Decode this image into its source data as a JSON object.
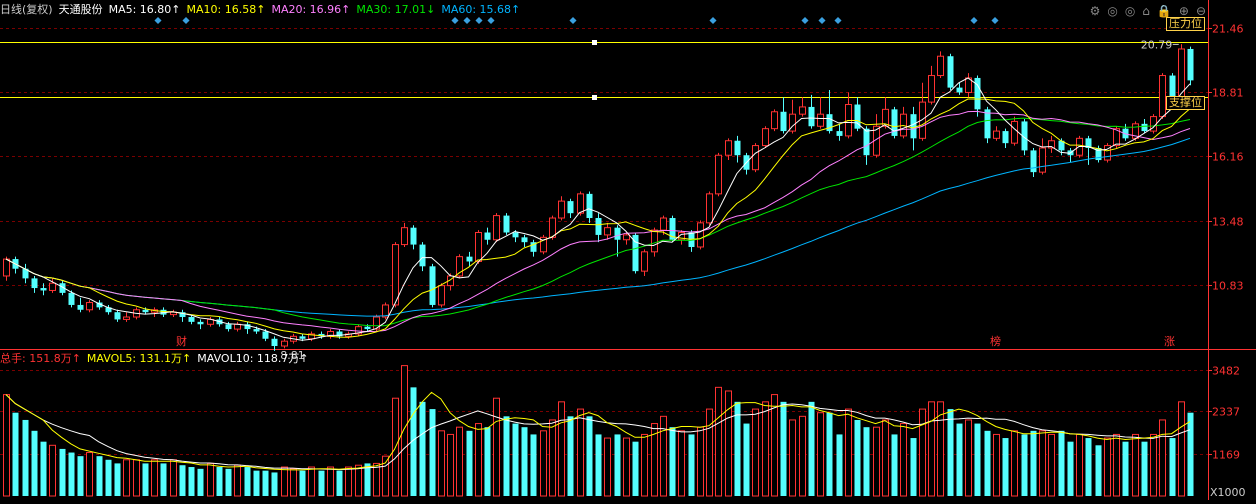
{
  "kline_header": {
    "period": "日线(复权)",
    "stock": "天通股份",
    "ma5": "MA5: 16.80↑",
    "ma10": "MA10: 16.58↑",
    "ma20": "MA20: 16.96↑",
    "ma30": "MA30: 17.01↓",
    "ma60": "MA60: 15.68↑"
  },
  "volume_header": {
    "total": "总手: 151.8万↑",
    "mavol5": "MAVOL5: 131.1万↑",
    "mavol10": "MAVOL10: 118.7万↑"
  },
  "toolbar_icons": [
    "settings-icon",
    "view-icon",
    "view2-icon",
    "home-icon",
    "lock-icon",
    "zoom-in-icon",
    "zoom-out-icon"
  ],
  "toolbar_glyphs": [
    "⚙",
    "◎",
    "◎",
    "⌂",
    "🔒",
    "⊕",
    "⊖"
  ],
  "levels": {
    "resistance": {
      "label": "压力位",
      "value": 20.9
    },
    "support": {
      "label": "支撑位",
      "value": 18.6
    }
  },
  "annotations": {
    "high": "20.79",
    "low": "8.81",
    "markers": [
      "财",
      "榜",
      "涨"
    ]
  },
  "colors": {
    "up": "#ff3232",
    "down": "#54ffff",
    "ma5": "#ffffff",
    "ma10": "#ffff00",
    "ma20": "#ff80ff",
    "ma30": "#00e600",
    "ma60": "#00b4ff",
    "grid": "#7a0000",
    "axis": "#ff3232",
    "level_line": "#ffff00"
  },
  "chart_data": [
    {
      "type": "candlestick",
      "yticks": [
        "10.83",
        "13.48",
        "16.16",
        "18.81",
        "21.46"
      ],
      "ylim": [
        8.3,
        21.8
      ],
      "grid": true,
      "candles": [
        [
          11.2,
          11.9,
          11.0,
          12.0
        ],
        [
          11.9,
          11.5,
          11.3,
          12.0
        ],
        [
          11.5,
          11.1,
          10.9,
          11.7
        ],
        [
          11.1,
          10.7,
          10.5,
          11.2
        ],
        [
          10.7,
          10.6,
          10.4,
          10.9
        ],
        [
          10.6,
          10.9,
          10.5,
          11.1
        ],
        [
          10.9,
          10.5,
          10.4,
          11.0
        ],
        [
          10.5,
          10.0,
          9.9,
          10.6
        ],
        [
          10.0,
          9.8,
          9.7,
          10.3
        ],
        [
          9.8,
          10.1,
          9.7,
          10.2
        ],
        [
          10.1,
          9.9,
          9.8,
          10.2
        ],
        [
          9.9,
          9.7,
          9.6,
          10.0
        ],
        [
          9.7,
          9.4,
          9.3,
          9.8
        ],
        [
          9.4,
          9.5,
          9.3,
          9.7
        ],
        [
          9.5,
          9.8,
          9.4,
          9.9
        ],
        [
          9.8,
          9.7,
          9.6,
          9.9
        ],
        [
          9.7,
          9.8,
          9.5,
          9.9
        ],
        [
          9.8,
          9.6,
          9.5,
          9.9
        ],
        [
          9.6,
          9.7,
          9.5,
          9.8
        ],
        [
          9.7,
          9.5,
          9.3,
          9.8
        ],
        [
          9.5,
          9.3,
          9.2,
          9.6
        ],
        [
          9.3,
          9.2,
          9.0,
          9.4
        ],
        [
          9.2,
          9.4,
          9.1,
          9.5
        ],
        [
          9.4,
          9.2,
          9.1,
          9.5
        ],
        [
          9.2,
          9.0,
          8.9,
          9.3
        ],
        [
          9.0,
          9.2,
          8.9,
          9.3
        ],
        [
          9.2,
          9.0,
          8.8,
          9.3
        ],
        [
          9.0,
          8.9,
          8.8,
          9.1
        ],
        [
          8.9,
          8.6,
          8.5,
          9.0
        ],
        [
          8.6,
          8.3,
          8.1,
          8.7
        ],
        [
          8.3,
          8.5,
          8.2,
          8.6
        ],
        [
          8.5,
          8.7,
          8.4,
          8.8
        ],
        [
          8.7,
          8.6,
          8.5,
          8.8
        ],
        [
          8.6,
          8.8,
          8.5,
          8.9
        ],
        [
          8.8,
          8.7,
          8.6,
          8.9
        ],
        [
          8.7,
          8.9,
          8.6,
          9.0
        ],
        [
          8.9,
          8.7,
          8.6,
          9.0
        ],
        [
          8.7,
          8.8,
          8.6,
          8.9
        ],
        [
          8.8,
          9.1,
          8.7,
          9.2
        ],
        [
          9.1,
          9.0,
          8.9,
          9.2
        ],
        [
          9.0,
          9.5,
          8.9,
          9.6
        ],
        [
          9.5,
          10.0,
          9.4,
          10.1
        ],
        [
          10.0,
          12.5,
          9.9,
          12.6
        ],
        [
          12.5,
          13.2,
          12.4,
          13.4
        ],
        [
          13.2,
          12.5,
          12.3,
          13.3
        ],
        [
          12.5,
          11.6,
          11.4,
          12.6
        ],
        [
          11.6,
          10.0,
          9.9,
          11.7
        ],
        [
          10.0,
          10.8,
          9.9,
          10.9
        ],
        [
          10.8,
          11.2,
          10.6,
          11.3
        ],
        [
          11.2,
          12.0,
          11.1,
          12.1
        ],
        [
          12.0,
          11.8,
          11.6,
          12.2
        ],
        [
          11.8,
          13.0,
          11.7,
          13.1
        ],
        [
          13.0,
          12.7,
          12.5,
          13.2
        ],
        [
          12.7,
          13.7,
          12.6,
          13.8
        ],
        [
          13.7,
          13.0,
          12.9,
          13.8
        ],
        [
          13.0,
          12.8,
          12.6,
          13.1
        ],
        [
          12.8,
          12.6,
          12.4,
          12.9
        ],
        [
          12.6,
          12.2,
          12.0,
          12.7
        ],
        [
          12.2,
          12.8,
          12.1,
          12.9
        ],
        [
          12.8,
          13.6,
          12.7,
          13.7
        ],
        [
          13.6,
          14.3,
          13.5,
          14.5
        ],
        [
          14.3,
          13.8,
          13.6,
          14.4
        ],
        [
          13.8,
          14.6,
          13.7,
          14.7
        ],
        [
          14.6,
          13.6,
          13.4,
          14.7
        ],
        [
          13.6,
          12.9,
          12.6,
          13.8
        ],
        [
          12.9,
          13.2,
          12.7,
          13.4
        ],
        [
          13.2,
          12.7,
          12.0,
          13.3
        ],
        [
          12.7,
          12.9,
          12.5,
          13.0
        ],
        [
          12.9,
          11.4,
          11.3,
          13.0
        ],
        [
          11.4,
          12.2,
          11.2,
          12.3
        ],
        [
          12.2,
          13.1,
          12.0,
          13.2
        ],
        [
          13.1,
          13.6,
          12.9,
          13.7
        ],
        [
          13.6,
          12.7,
          12.6,
          13.7
        ],
        [
          12.7,
          13.0,
          12.5,
          13.1
        ],
        [
          13.0,
          12.4,
          12.2,
          13.1
        ],
        [
          12.4,
          13.4,
          12.3,
          13.5
        ],
        [
          13.4,
          14.6,
          13.3,
          14.7
        ],
        [
          14.6,
          16.2,
          14.5,
          16.3
        ],
        [
          16.2,
          16.8,
          16.0,
          16.9
        ],
        [
          16.8,
          16.2,
          15.9,
          17.0
        ],
        [
          16.2,
          15.6,
          15.4,
          16.3
        ],
        [
          15.6,
          16.6,
          15.5,
          16.7
        ],
        [
          16.6,
          17.3,
          16.5,
          17.4
        ],
        [
          17.3,
          18.0,
          17.2,
          18.1
        ],
        [
          18.0,
          17.2,
          17.1,
          18.6
        ],
        [
          17.2,
          17.9,
          17.1,
          18.5
        ],
        [
          17.9,
          18.2,
          17.8,
          18.6
        ],
        [
          18.2,
          17.4,
          17.3,
          18.7
        ],
        [
          17.4,
          17.9,
          17.3,
          18.6
        ],
        [
          17.9,
          17.2,
          17.1,
          18.9
        ],
        [
          17.2,
          17.0,
          16.8,
          17.5
        ],
        [
          17.0,
          18.3,
          16.9,
          18.8
        ],
        [
          18.3,
          17.3,
          17.2,
          18.6
        ],
        [
          17.3,
          16.2,
          15.8,
          17.4
        ],
        [
          16.2,
          17.4,
          16.1,
          17.9
        ],
        [
          17.4,
          18.1,
          17.3,
          18.6
        ],
        [
          18.1,
          17.0,
          16.9,
          18.2
        ],
        [
          17.0,
          17.9,
          16.9,
          18.2
        ],
        [
          17.9,
          16.9,
          16.4,
          18.2
        ],
        [
          16.9,
          18.4,
          16.8,
          19.2
        ],
        [
          18.4,
          19.5,
          18.3,
          19.9
        ],
        [
          19.5,
          20.3,
          19.4,
          20.5
        ],
        [
          20.3,
          19.0,
          18.9,
          20.4
        ],
        [
          19.0,
          18.8,
          18.7,
          19.2
        ],
        [
          18.8,
          19.4,
          18.6,
          19.6
        ],
        [
          19.4,
          18.1,
          17.8,
          19.5
        ],
        [
          18.1,
          16.9,
          16.7,
          18.2
        ],
        [
          16.9,
          17.2,
          16.8,
          17.4
        ],
        [
          17.2,
          16.7,
          16.5,
          17.3
        ],
        [
          16.7,
          17.6,
          16.6,
          17.8
        ],
        [
          17.6,
          16.4,
          16.2,
          17.7
        ],
        [
          16.4,
          15.5,
          15.3,
          16.5
        ],
        [
          15.5,
          16.5,
          15.4,
          16.9
        ],
        [
          16.5,
          16.8,
          16.3,
          17.0
        ],
        [
          16.8,
          16.4,
          16.2,
          16.9
        ],
        [
          16.4,
          16.2,
          15.9,
          16.5
        ],
        [
          16.2,
          16.9,
          16.1,
          17.0
        ],
        [
          16.9,
          16.5,
          15.8,
          17.0
        ],
        [
          16.5,
          16.0,
          15.9,
          16.6
        ],
        [
          16.0,
          16.6,
          15.9,
          16.7
        ],
        [
          16.6,
          17.3,
          16.5,
          17.4
        ],
        [
          17.3,
          16.9,
          16.8,
          17.5
        ],
        [
          16.9,
          17.5,
          16.8,
          17.6
        ],
        [
          17.5,
          17.2,
          17.1,
          17.7
        ],
        [
          17.2,
          17.8,
          17.1,
          17.9
        ],
        [
          17.8,
          19.5,
          17.7,
          19.6
        ],
        [
          19.5,
          18.6,
          18.5,
          19.6
        ],
        [
          18.6,
          20.6,
          18.5,
          20.8
        ],
        [
          20.6,
          19.3,
          19.1,
          20.7
        ]
      ]
    },
    {
      "type": "bar",
      "yticks": [
        "1169",
        "2337",
        "3482"
      ],
      "ylim": [
        0,
        3700
      ],
      "unit_label": "X1000",
      "volumes": [
        2800,
        2300,
        2100,
        1800,
        1500,
        1400,
        1300,
        1200,
        1100,
        1200,
        1100,
        1000,
        900,
        1000,
        1000,
        900,
        1000,
        900,
        1000,
        850,
        800,
        750,
        900,
        800,
        750,
        850,
        800,
        700,
        700,
        650,
        800,
        750,
        700,
        800,
        700,
        800,
        700,
        800,
        850,
        900,
        900,
        1100,
        2700,
        3600,
        3000,
        2600,
        2400,
        1800,
        1700,
        1900,
        1800,
        2000,
        1900,
        2700,
        2200,
        2000,
        1900,
        1700,
        1800,
        2100,
        2600,
        2200,
        2400,
        2200,
        1700,
        1600,
        1700,
        1600,
        1500,
        1700,
        2000,
        2200,
        1900,
        1800,
        1700,
        1900,
        2400,
        3000,
        2900,
        2600,
        2000,
        2400,
        2600,
        2800,
        2600,
        2100,
        2200,
        2600,
        2300,
        2300,
        1700,
        2400,
        2100,
        1900,
        1900,
        2100,
        1700,
        2000,
        1600,
        2400,
        2600,
        2600,
        2400,
        2000,
        2100,
        2000,
        1800,
        1700,
        1600,
        1800,
        1700,
        1800,
        1800,
        1700,
        1800,
        1500,
        1700,
        1600,
        1400,
        1600,
        1700,
        1500,
        1700,
        1500,
        1700,
        2100,
        1600,
        2600,
        2300
      ]
    }
  ]
}
